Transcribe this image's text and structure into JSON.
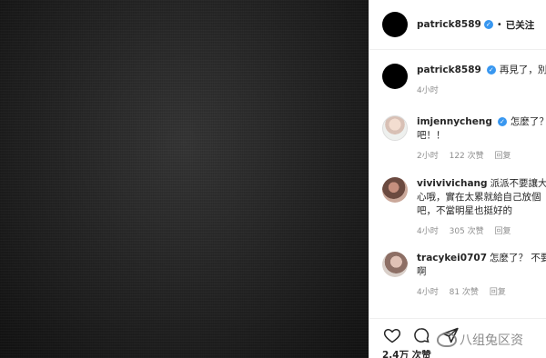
{
  "header": {
    "username": "patrick8589",
    "separator": "•",
    "follow_state": "已关注"
  },
  "comments": [
    {
      "user": "patrick8589",
      "lines": [
        "再見了，別再"
      ],
      "time": "4小时",
      "likes": "",
      "reply": ""
    },
    {
      "user": "imjennycheng",
      "lines": [
        "怎麼了？沒",
        "吧！！"
      ],
      "time": "2小时",
      "likes": "122 次赞",
      "reply": "回复"
    },
    {
      "user": "vivivivichang",
      "lines": [
        "派派不要讓大家",
        "心哦，實在太累就給自己放個",
        "吧，不當明星也挺好的"
      ],
      "time": "4小时",
      "likes": "305 次赞",
      "reply": "回复"
    },
    {
      "user": "tracykei0707",
      "lines": [
        "怎麼了？ 不要嚇",
        "啊"
      ],
      "time": "4小时",
      "likes": "81 次赞",
      "reply": "回复"
    }
  ],
  "actions": {
    "likes_summary": "2.4万 次赞"
  },
  "watermark": {
    "text": "八组兔区资"
  },
  "colors": {
    "accent": "#3897f0",
    "meta": "#8e8e8e",
    "text": "#262626"
  }
}
